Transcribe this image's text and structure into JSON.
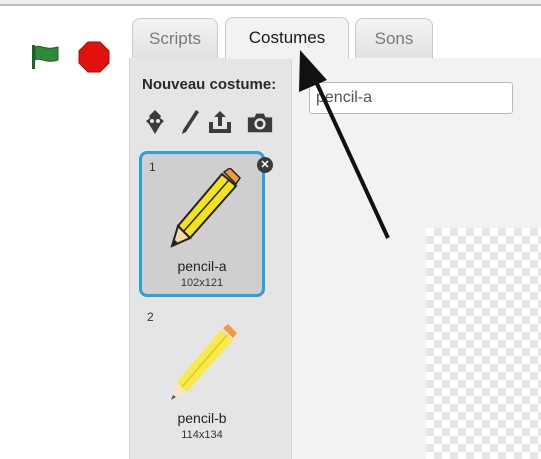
{
  "tabs": [
    {
      "label": "Scripts",
      "active": false
    },
    {
      "label": "Costumes",
      "active": true
    },
    {
      "label": "Sons",
      "active": false
    }
  ],
  "new_costume": {
    "label": "Nouveau costume:",
    "tools": [
      "sprite-library-icon",
      "paint-brush-icon",
      "upload-icon",
      "camera-icon"
    ]
  },
  "costume_name_field": {
    "value": "pencil-a"
  },
  "costumes": [
    {
      "number": "1",
      "name": "pencil-a",
      "size": "102x121",
      "selected": true
    },
    {
      "number": "2",
      "name": "pencil-b",
      "size": "114x134",
      "selected": false
    }
  ],
  "controls": {
    "green_flag": "green-flag-icon",
    "stop": "stop-icon"
  },
  "colors": {
    "selection": "#2aa2d9",
    "flag": "#2e8a3a",
    "stop": "#e0120f",
    "pencil_body": "#f5e31a",
    "pencil_eraser": "#f29a3d"
  }
}
